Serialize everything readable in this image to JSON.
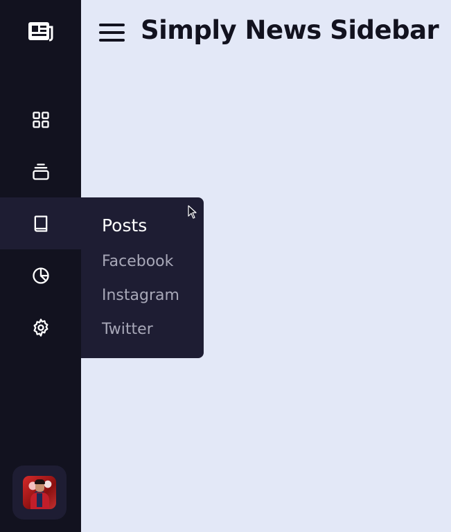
{
  "header": {
    "title": "Simply News Sidebar",
    "menu_icon": "hamburger-menu-icon"
  },
  "sidebar": {
    "logo_icon": "newspaper-icon",
    "items": [
      {
        "id": "dashboard",
        "icon": "grid-icon",
        "active": false
      },
      {
        "id": "stack",
        "icon": "stack-icon",
        "active": false
      },
      {
        "id": "posts",
        "icon": "book-icon",
        "active": true
      },
      {
        "id": "analytics",
        "icon": "pie-chart-icon",
        "active": false
      },
      {
        "id": "settings",
        "icon": "gear-icon",
        "active": false
      }
    ]
  },
  "flyout": {
    "title": "Posts",
    "links": [
      "Facebook",
      "Instagram",
      "Twitter"
    ]
  },
  "colors": {
    "sidebar_bg": "#12121f",
    "active_bg": "#1e1d33",
    "page_bg": "#e3e8f7",
    "muted_text": "#a8a8b8"
  }
}
